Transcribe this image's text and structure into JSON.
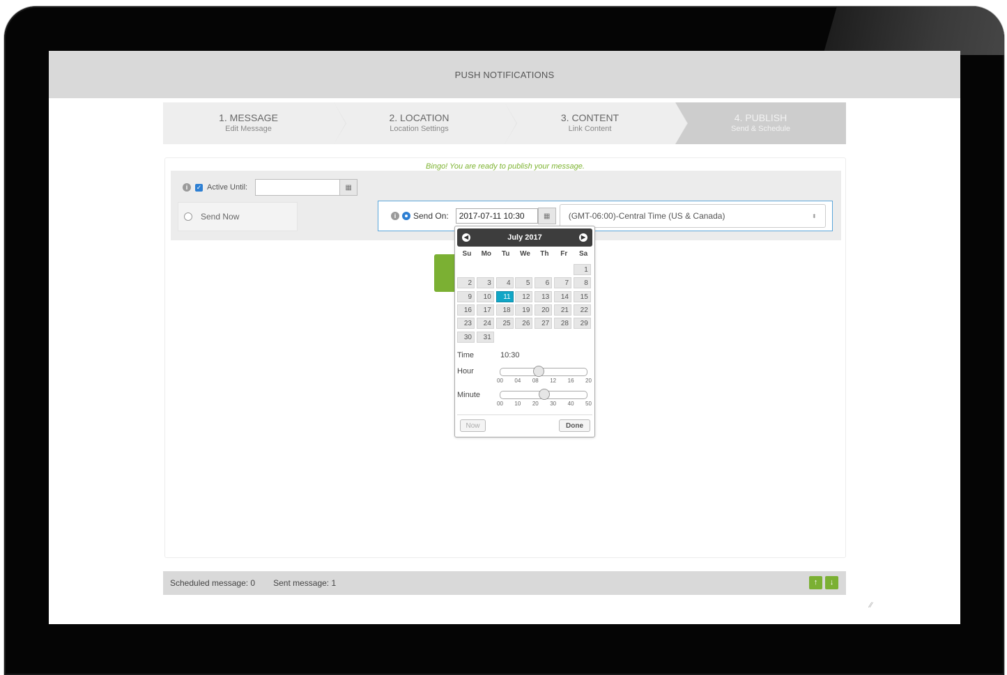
{
  "app": {
    "title": "PUSH NOTIFICATIONS"
  },
  "steps": [
    {
      "title": "1. MESSAGE",
      "subtitle": "Edit Message"
    },
    {
      "title": "2. LOCATION",
      "subtitle": "Location Settings"
    },
    {
      "title": "3. CONTENT",
      "subtitle": "Link Content"
    },
    {
      "title": "4. PUBLISH",
      "subtitle": "Send & Schedule"
    }
  ],
  "publish": {
    "success_message": "Bingo! You are ready to publish your message.",
    "active_until_label": "Active Until:",
    "active_until_value": "",
    "send_now_label": "Send Now",
    "send_on_label": "Send On:",
    "send_on_value": "2017-07-11 10:30",
    "timezone": "(GMT-06:00)-Central Time (US & Canada)"
  },
  "datepicker": {
    "month_label": "July 2017",
    "weekdays": [
      "Su",
      "Mo",
      "Tu",
      "We",
      "Th",
      "Fr",
      "Sa"
    ],
    "days": [
      "1",
      "2",
      "3",
      "4",
      "5",
      "6",
      "7",
      "8",
      "9",
      "10",
      "11",
      "12",
      "13",
      "14",
      "15",
      "16",
      "17",
      "18",
      "19",
      "20",
      "21",
      "22",
      "23",
      "24",
      "25",
      "26",
      "27",
      "28",
      "29",
      "30",
      "31"
    ],
    "selected_day": "11",
    "first_day_weekday_index": 6,
    "time_label": "Time",
    "time_value": "10:30",
    "hour_label": "Hour",
    "minute_label": "Minute",
    "hour_ticks": [
      "00",
      "04",
      "08",
      "12",
      "16",
      "20"
    ],
    "minute_ticks": [
      "00",
      "10",
      "20",
      "30",
      "40",
      "50"
    ],
    "hour_value": 10,
    "minute_value": 30,
    "now_button": "Now",
    "done_button": "Done"
  },
  "footer": {
    "scheduled_label": "Scheduled message: 0",
    "sent_label": "Sent message: 1",
    "up_icon": "↑",
    "down_icon": "↓"
  },
  "colors": {
    "accent_green": "#7bb033",
    "selected_day": "#11a6c6",
    "radio_blue": "#2d7fd3"
  }
}
